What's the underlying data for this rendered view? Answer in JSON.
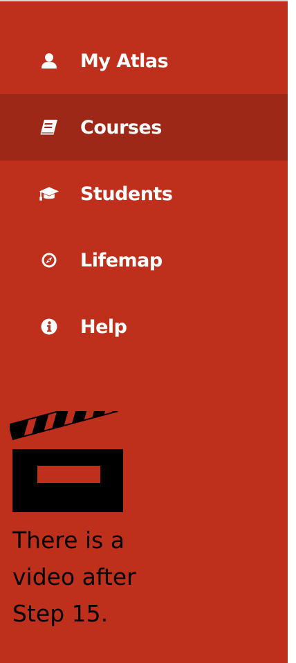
{
  "nav": {
    "items": [
      {
        "label": "My Atlas",
        "icon": "user-icon",
        "active": false
      },
      {
        "label": "Courses",
        "icon": "book-icon",
        "active": true
      },
      {
        "label": "Students",
        "icon": "graduation-cap-icon",
        "active": false
      },
      {
        "label": "Lifemap",
        "icon": "compass-icon",
        "active": false
      },
      {
        "label": "Help",
        "icon": "info-circle-icon",
        "active": false
      }
    ]
  },
  "video_note": {
    "icon": "clapperboard-icon",
    "lines": [
      "There is a",
      "video after",
      "Step 15."
    ]
  },
  "colors": {
    "sidebar_background": "#bf301c",
    "active_item_background": "#9e2817",
    "nav_text": "#ffffff",
    "note_text": "#000000"
  }
}
